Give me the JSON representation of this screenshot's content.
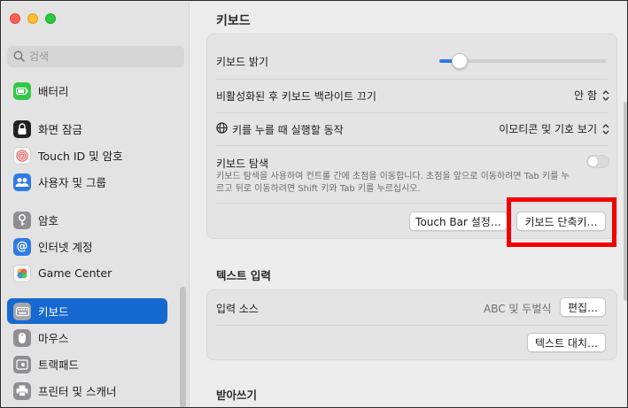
{
  "window": {
    "title": "키보드"
  },
  "sidebar": {
    "search": {
      "placeholder": "검색"
    },
    "items": [
      {
        "label": "배터리",
        "icon": "battery-icon",
        "color": "#33c648"
      },
      {
        "label": "화면 잠금",
        "icon": "lock-icon",
        "color": "#222222"
      },
      {
        "label": "Touch ID 및 암호",
        "icon": "fingerprint-icon",
        "color": "#f2f2f2"
      },
      {
        "label": "사용자 및 그룹",
        "icon": "users-icon",
        "color": "#2f7ae5"
      },
      {
        "label": "암호",
        "icon": "key-icon",
        "color": "#8e8e93"
      },
      {
        "label": "인터넷 계정",
        "icon": "at-icon",
        "color": "#2f7ae5"
      },
      {
        "label": "Game Center",
        "icon": "game-center-icon",
        "color": "#f2f2f2"
      },
      {
        "label": "키보드",
        "icon": "keyboard-icon",
        "color": "#8e8e93",
        "active": true
      },
      {
        "label": "마우스",
        "icon": "mouse-icon",
        "color": "#8e8e93"
      },
      {
        "label": "트랙패드",
        "icon": "trackpad-icon",
        "color": "#8e8e93"
      },
      {
        "label": "프린터 및 스캐너",
        "icon": "printer-icon",
        "color": "#8e8e93"
      }
    ]
  },
  "keyboard_section": {
    "brightness_label": "키보드 밝기",
    "brightness_value": 0.08,
    "backlight_off_label": "비활성화된 후 키보드 백라이트 끄기",
    "backlight_off_value": "안 함",
    "globe_key_label": "키를 누를 때 실행할 동작",
    "globe_key_value": "이모티콘 및 기호 보기",
    "nav_label": "키보드 탐색",
    "nav_description": "키보드 탐색을 사용하여 컨트롤 간에 초점을 이동합니다. 초점을 앞으로 이동하려면 Tab 키를 누르고 뒤로 이동하려면 Shift 키와 Tab 키를 누르십시오.",
    "nav_enabled": false,
    "touchbar_button": "Touch Bar 설정…",
    "shortcuts_button": "키보드 단축키…"
  },
  "text_input": {
    "section_title": "텍스트 입력",
    "input_sources_label": "입력 소스",
    "input_sources_value": "ABC 및 두벌식",
    "edit_button": "편집…",
    "text_replacement_button": "텍스트 대치…"
  },
  "dictation": {
    "section_title": "받아쓰기"
  },
  "colors": {
    "accent": "#2f7ae5",
    "sidebar_selected": "#1569d1",
    "highlight_box": "#f20000"
  }
}
